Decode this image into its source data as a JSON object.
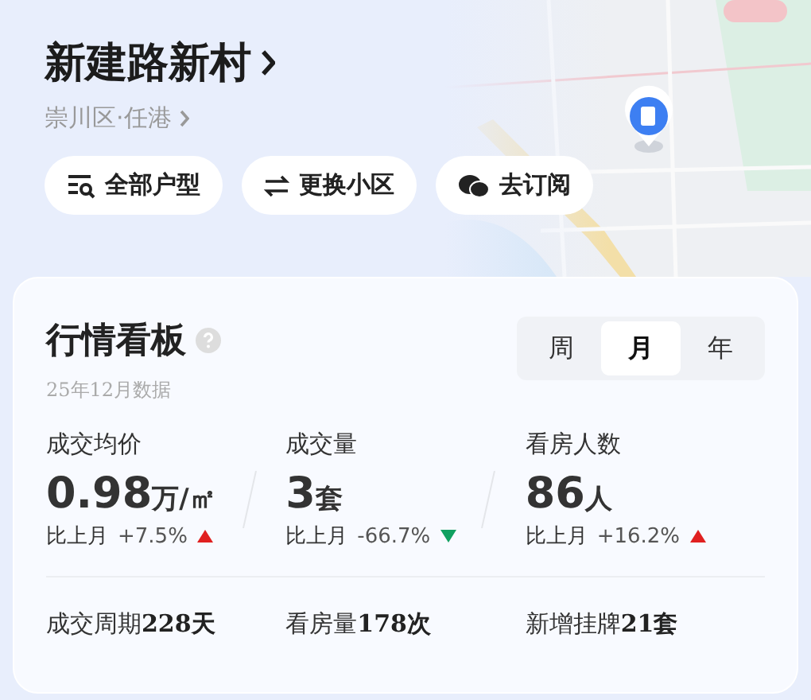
{
  "header": {
    "title": "新建路新村",
    "location": "崇川区·任港"
  },
  "actions": [
    {
      "kind": "filter",
      "label": "全部户型"
    },
    {
      "kind": "swap",
      "label": "更换小区"
    },
    {
      "kind": "wechat",
      "label": "去订阅"
    }
  ],
  "board": {
    "title": "行情看板",
    "subtitle": "25年12月数据",
    "periods": [
      {
        "label": "周",
        "selected": false
      },
      {
        "label": "月",
        "selected": true
      },
      {
        "label": "年",
        "selected": false
      }
    ],
    "stats": [
      {
        "label": "成交均价",
        "value": "0.98",
        "unit": "万/㎡",
        "compare": "比上月",
        "change": "+7.5%",
        "kind": "up"
      },
      {
        "label": "成交量",
        "value": "3",
        "unit": "套",
        "compare": "比上月",
        "change": "-66.7%",
        "kind": "down"
      },
      {
        "label": "看房人数",
        "value": "86",
        "unit": "人",
        "compare": "比上月",
        "change": "+16.2%",
        "kind": "up"
      }
    ],
    "footer": [
      "成交周期**228天**",
      "看房量**178次**",
      "新增挂牌**21套**"
    ]
  }
}
